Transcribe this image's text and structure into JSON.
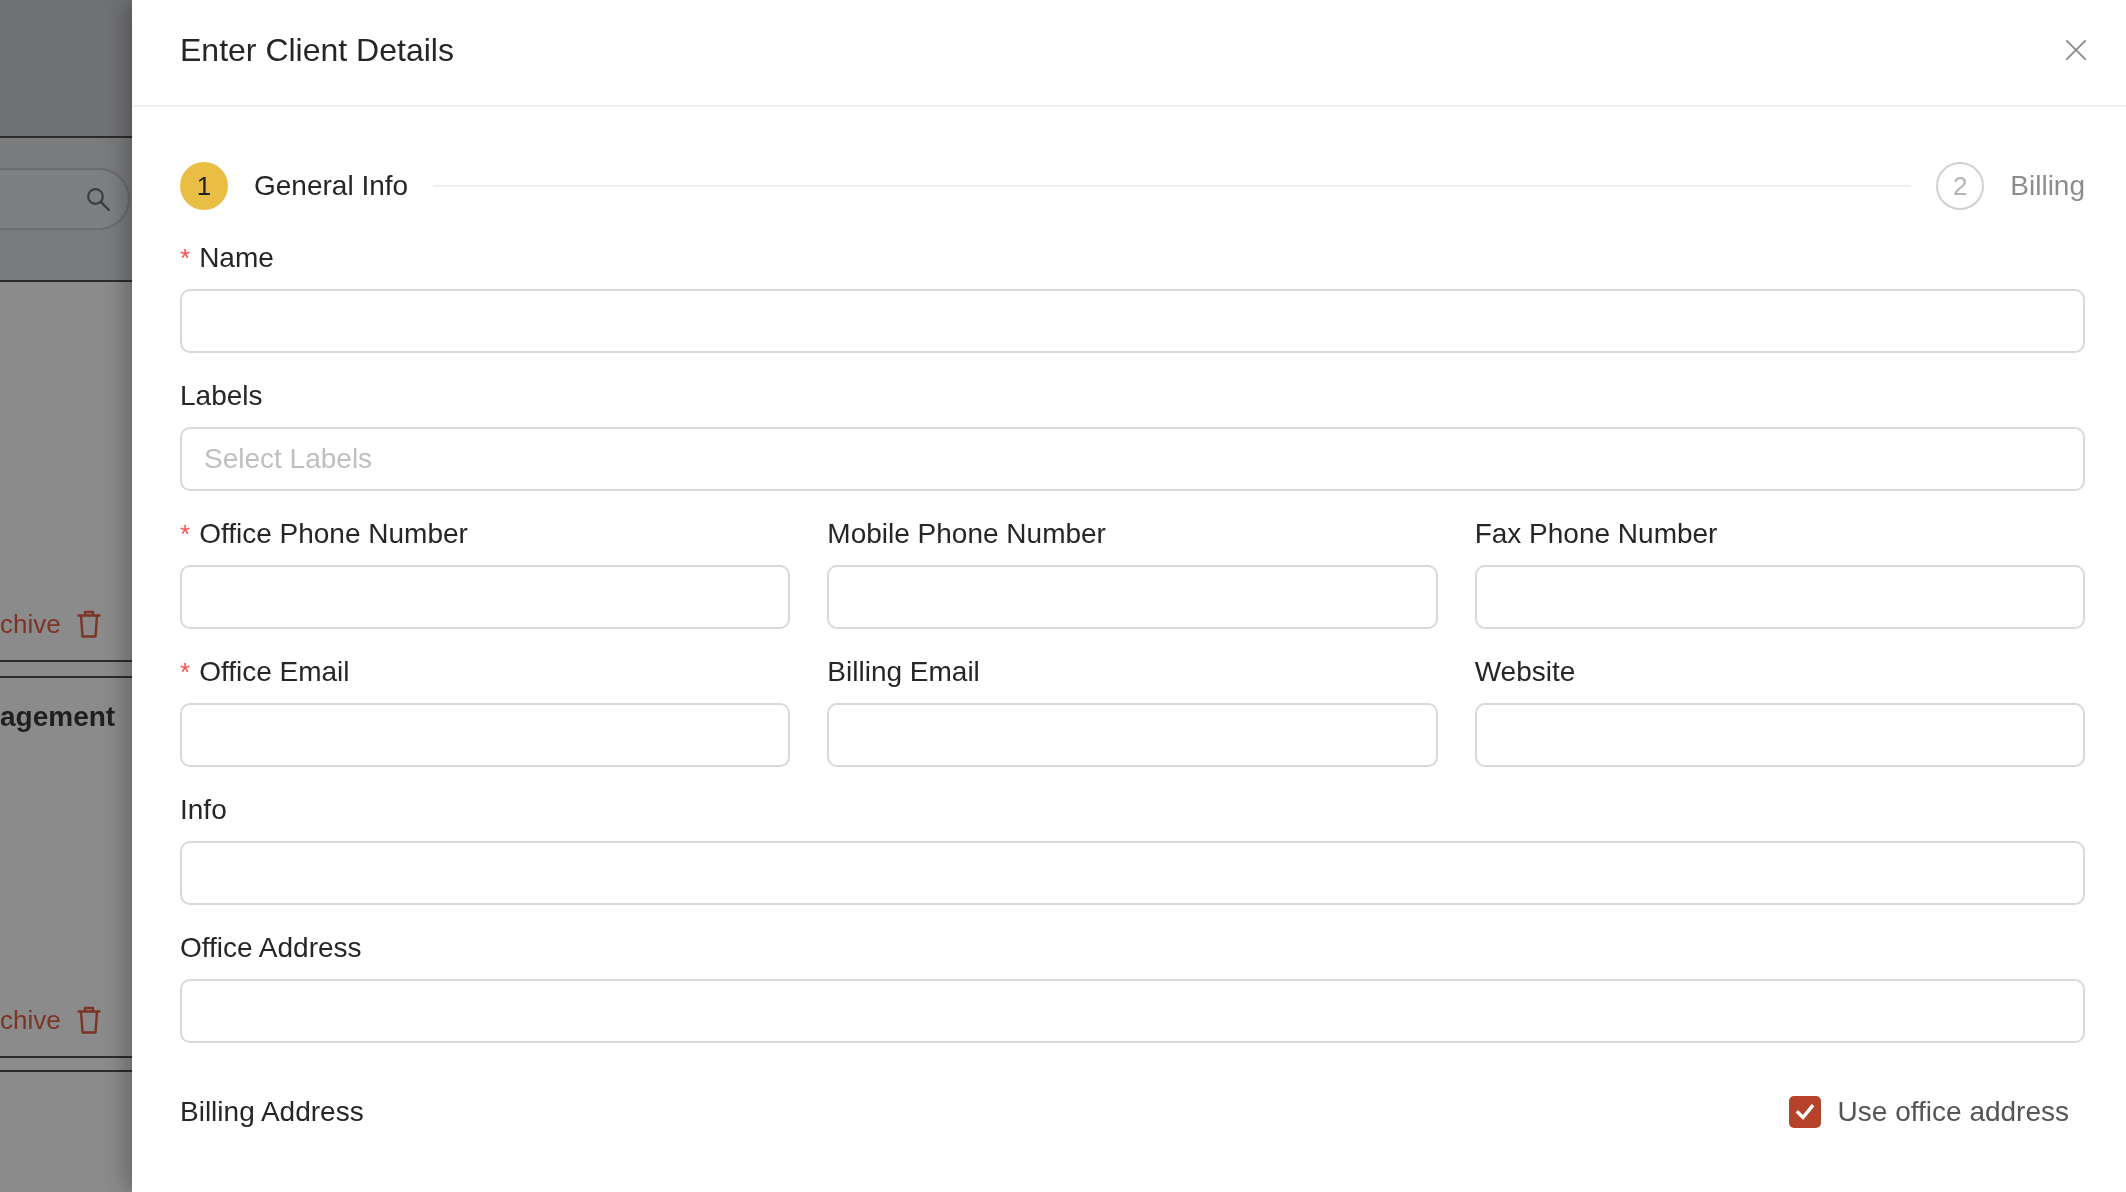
{
  "background_page": {
    "cards": [
      {
        "action": "chive"
      },
      {
        "title": "agement",
        "action": "chive"
      }
    ]
  },
  "drawer": {
    "title": "Enter Client Details",
    "steps": [
      {
        "number": "1",
        "label": "General Info",
        "selected": true
      },
      {
        "number": "2",
        "label": "Billing",
        "selected": false
      }
    ],
    "rows": [
      {
        "fields": [
          {
            "label": "Name",
            "required_mark": "*"
          }
        ]
      },
      {
        "fields": [
          {
            "label": "Labels",
            "placeholder": "Select Labels"
          }
        ]
      },
      {
        "fields": [
          {
            "label": "Office Phone Number",
            "required_mark": "*"
          },
          {
            "label": "Mobile Phone Number"
          },
          {
            "label": "Fax Phone Number"
          }
        ]
      },
      {
        "fields": [
          {
            "label": "Office Email",
            "required_mark": "*"
          },
          {
            "label": "Billing Email"
          },
          {
            "label": "Website"
          }
        ]
      },
      {
        "fields": [
          {
            "label": "Info"
          }
        ]
      },
      {
        "fields": [
          {
            "label": "Office Address"
          }
        ]
      }
    ],
    "billing_address": {
      "label": "Billing Address",
      "use_office_address": {
        "label": "Use office address",
        "checked": true
      }
    }
  }
}
